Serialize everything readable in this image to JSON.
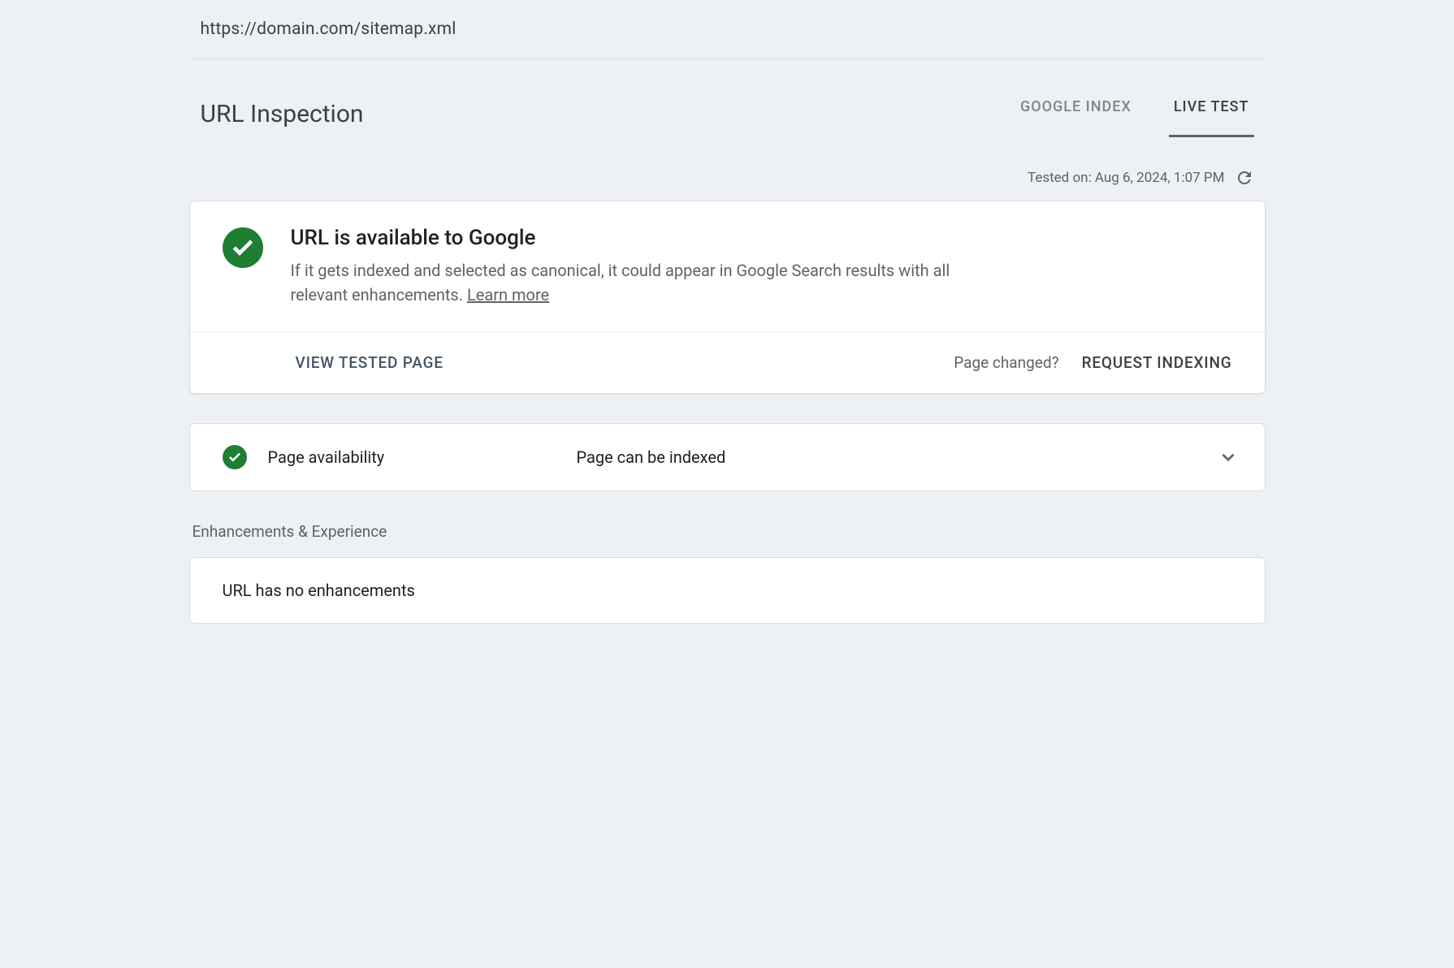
{
  "url": "https://domain.com/sitemap.xml",
  "page_title": "URL Inspection",
  "tabs": {
    "google_index": "GOOGLE INDEX",
    "live_test": "LIVE TEST"
  },
  "tested_on_label": "Tested on: Aug 6, 2024, 1:07 PM",
  "status": {
    "title": "URL is available to Google",
    "description": "If it gets indexed and selected as canonical, it could appear in Google Search results with all relevant enhancements. ",
    "learn_more": "Learn more"
  },
  "actions": {
    "view_tested_page": "VIEW TESTED PAGE",
    "page_changed": "Page changed?",
    "request_indexing": "REQUEST INDEXING"
  },
  "availability": {
    "label": "Page availability",
    "value": "Page can be indexed"
  },
  "enhancements": {
    "heading": "Enhancements & Experience",
    "message": "URL has no enhancements"
  }
}
